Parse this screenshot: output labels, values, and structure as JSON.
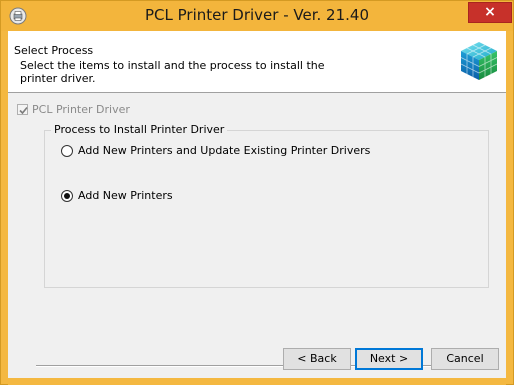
{
  "window": {
    "title": "PCL Printer Driver - Ver. 21.40",
    "close_glyph": "×",
    "icon": "printer-app-icon",
    "accent_color": "#f3b53c",
    "close_color": "#c7312a"
  },
  "header": {
    "title": "Select Process",
    "description": "Select the items to install and the process to install the printer driver.",
    "logo_icon": "cube-logo-icon"
  },
  "feature": {
    "label": "PCL Printer Driver",
    "checked": true,
    "enabled": false
  },
  "process_group": {
    "legend": "Process to Install Printer Driver",
    "options": [
      {
        "label": "Add New Printers and Update Existing Printer Drivers",
        "selected": false
      },
      {
        "label": "Add New Printers",
        "selected": true
      }
    ]
  },
  "buttons": {
    "back": "< Back",
    "next": "Next >",
    "cancel": "Cancel"
  }
}
